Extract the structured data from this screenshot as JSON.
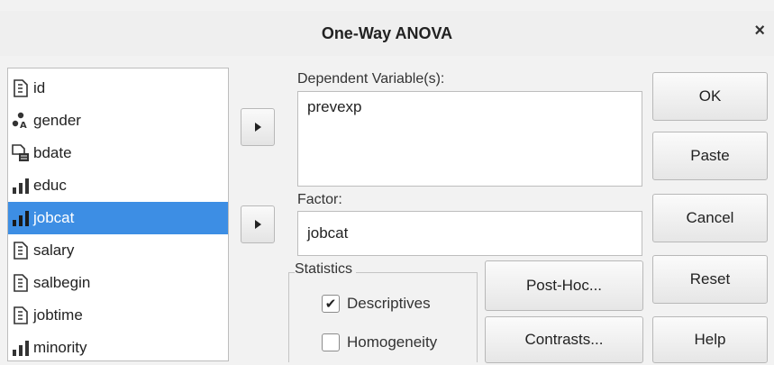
{
  "window": {
    "title": "One-Way ANOVA",
    "close_glyph": "×"
  },
  "variables": [
    {
      "name": "id",
      "type": "scale-icon",
      "selected": false
    },
    {
      "name": "gender",
      "type": "nominal-string-icon",
      "selected": false
    },
    {
      "name": "bdate",
      "type": "date-icon",
      "selected": false
    },
    {
      "name": "educ",
      "type": "ordinal-icon",
      "selected": false
    },
    {
      "name": "jobcat",
      "type": "ordinal-icon",
      "selected": true
    },
    {
      "name": "salary",
      "type": "scale-icon",
      "selected": false
    },
    {
      "name": "salbegin",
      "type": "scale-icon",
      "selected": false
    },
    {
      "name": "jobtime",
      "type": "scale-icon",
      "selected": false
    },
    {
      "name": "minority",
      "type": "ordinal-icon",
      "selected": false
    }
  ],
  "dependent": {
    "label": "Dependent Variable(s):",
    "value": "prevexp"
  },
  "factor": {
    "label": "Factor:",
    "value": "jobcat"
  },
  "statistics": {
    "label": "Statistics",
    "options": [
      {
        "label": "Descriptives",
        "checked": true
      },
      {
        "label": "Homogeneity",
        "checked": false
      }
    ]
  },
  "buttons": {
    "post_hoc": "Post-Hoc...",
    "contrasts": "Contrasts...",
    "ok": "OK",
    "paste": "Paste",
    "cancel": "Cancel",
    "reset": "Reset",
    "help": "Help"
  },
  "colors": {
    "selection": "#3d8ee4",
    "dialog_bg": "#f2f2f2"
  }
}
